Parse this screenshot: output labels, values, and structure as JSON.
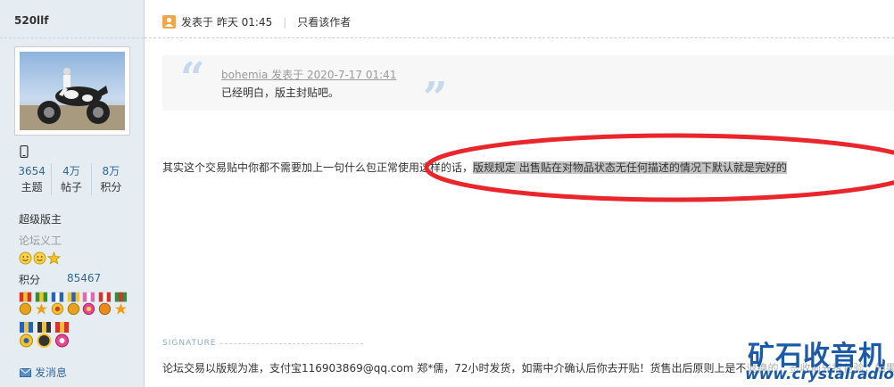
{
  "author": {
    "name": "520llf",
    "stats": [
      {
        "value": "3654",
        "label": "主题"
      },
      {
        "value": "4万",
        "label": "帖子"
      },
      {
        "value": "8万",
        "label": "积分"
      }
    ],
    "group": "超级版主",
    "custom_title": "论坛义工",
    "points_label": "积分",
    "points_value": "85467",
    "pm_label": "发消息"
  },
  "post": {
    "posted_label": "发表于 昨天 01:45",
    "only_author": "只看该作者",
    "quote": {
      "meta": "bohemia 发表于 2020-7-17 01:41",
      "text": "已经明白，版主封贴吧。"
    },
    "body_plain": "其实这个交易贴中你都不需要加上一句什么包正常使用这样的话，",
    "body_highlight": "版规规定 出售贴在对物品状态无任何描述的情况下默认就是完好的",
    "signature_label": "SIGNATURE",
    "signature_text": "论坛交易以版规为准，支付宝116903869@qq.com 郑*儒，72小时发货，如需中介确认后你去开贴！货售出后原则上是不退换的，签收前先拆包验，如果是"
  },
  "watermark": {
    "cn": "矿石收音机",
    "url": "www.crystalradio.cn"
  },
  "colors": {
    "sidebar_bg": "#e5edf2",
    "link": "#336699",
    "annotation_red": "#e8262b"
  }
}
